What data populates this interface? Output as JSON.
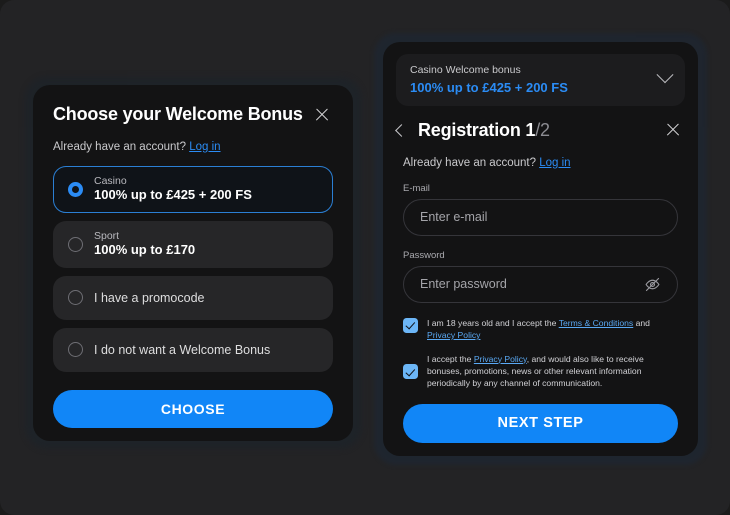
{
  "colors": {
    "page_bg": "#232325",
    "panel_bg": "#131314",
    "accent_blue": "#1186f7",
    "link_blue": "#2b8cf5",
    "checkbox_blue": "#6cb6f7",
    "option_bg": "#262628",
    "selected_border": "#2b7fd4"
  },
  "left_panel": {
    "title": "Choose your Welcome Bonus",
    "close_icon": "close-icon",
    "account_prompt": "Already have an account?",
    "login_link": "Log in",
    "options": [
      {
        "id": "casino",
        "label": "Casino",
        "value": "100% up to £425 + 200 FS",
        "selected": true,
        "two_line": true
      },
      {
        "id": "sport",
        "label": "Sport",
        "value": "100% up to £170",
        "selected": false,
        "two_line": true
      },
      {
        "id": "promocode",
        "label": "I have a promocode",
        "value": "",
        "selected": false,
        "two_line": false
      },
      {
        "id": "no-bonus",
        "label": "I do not want a Welcome Bonus",
        "value": "",
        "selected": false,
        "two_line": false
      }
    ],
    "choose_button": "CHOOSE"
  },
  "right_panel": {
    "banner": {
      "title": "Casino Welcome bonus",
      "value": "100% up to £425 + 200 FS",
      "expand_icon": "chevron-down-icon"
    },
    "back_icon": "chevron-left-icon",
    "close_icon": "close-icon",
    "title_main": "Registration 1",
    "title_dim": "/2",
    "account_prompt": "Already have an account?",
    "login_link": "Log in",
    "email": {
      "label": "E-mail",
      "placeholder": "Enter e-mail",
      "value": ""
    },
    "password": {
      "label": "Password",
      "placeholder": "Enter password",
      "value": "",
      "toggle_icon": "eye-off-icon"
    },
    "consents": [
      {
        "id": "age-terms",
        "checked": true,
        "part1": "I am 18 years old and I accept the ",
        "link1": "Terms & Conditions",
        "part2": " and ",
        "link2": "Privacy Policy",
        "part3": ""
      },
      {
        "id": "marketing",
        "checked": true,
        "part1": "I accept the ",
        "link1": "Privacy Policy",
        "part2": ", and would also like to receive bonuses, promotions, news or other relevant information periodically by any channel of communication.",
        "link2": "",
        "part3": ""
      }
    ],
    "next_button": "NEXT STEP"
  }
}
